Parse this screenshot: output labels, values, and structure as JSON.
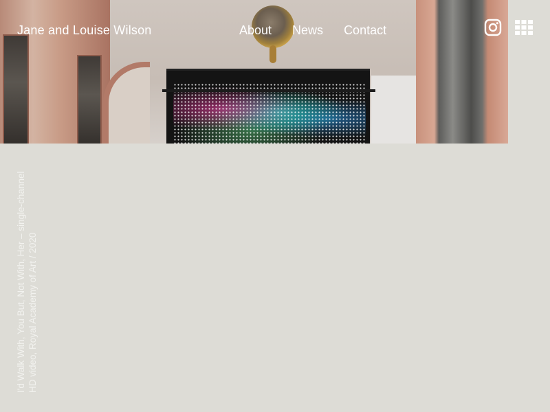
{
  "header": {
    "site_title": "Jane and Louise Wilson",
    "nav": [
      {
        "label": "About"
      },
      {
        "label": "News"
      },
      {
        "label": "Contact"
      }
    ],
    "icons": {
      "instagram": "instagram-icon",
      "menu": "grid-menu-icon"
    },
    "text_color": "#ffffff"
  },
  "caption": {
    "line1": "I'd Walk With, You But, Not With, Her – single-channel",
    "line2": "HD video, Royal Academy of Art / 2020",
    "color": "#f2f2ef"
  },
  "page": {
    "background_color": "#dddcd6"
  }
}
